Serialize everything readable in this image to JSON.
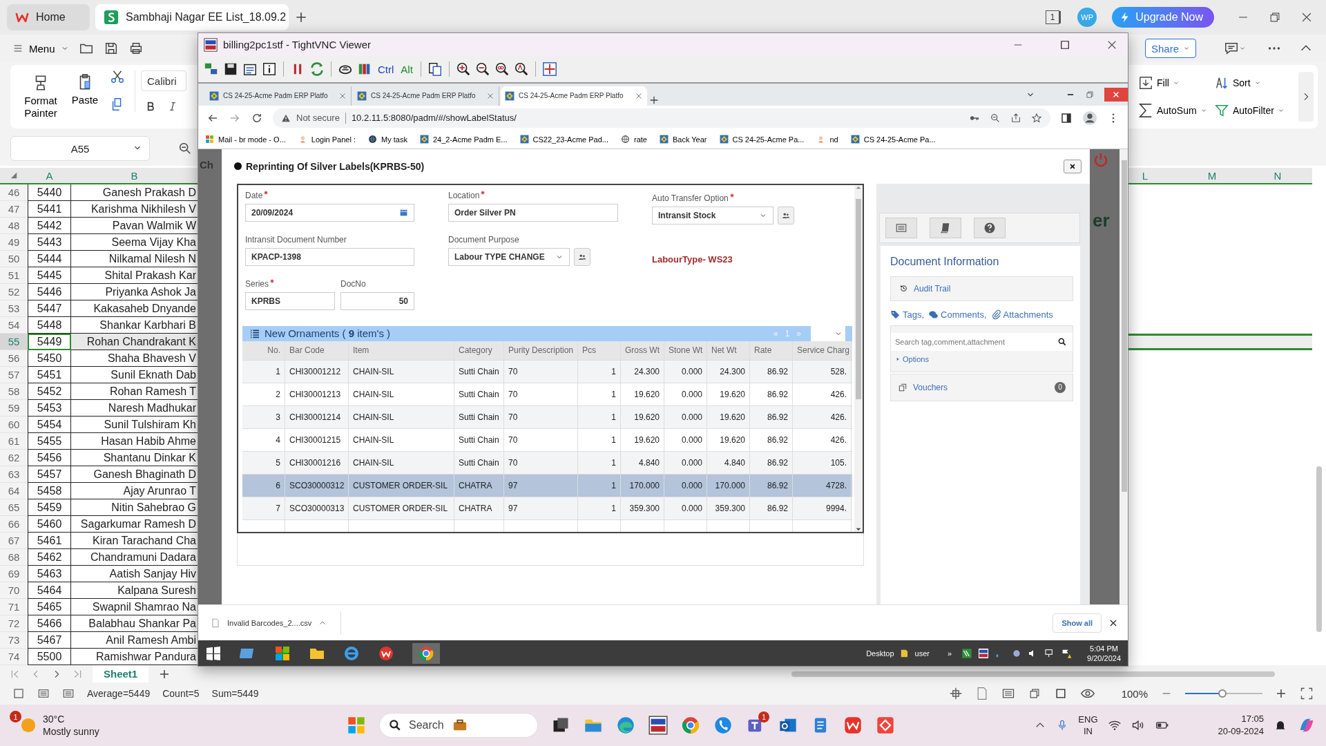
{
  "wps": {
    "tabs": [
      {
        "label": "Home",
        "selected": false
      },
      {
        "label": "Sambhaji Nagar EE List_18.09.2",
        "selected": true
      }
    ],
    "window_count": "1",
    "avatar": "WP",
    "upgrade": "Upgrade Now",
    "menu": "Menu",
    "share": "Share",
    "ribbon_left": [
      "Format Painter",
      "Paste"
    ],
    "font": "Calibri",
    "ribbon_right": [
      "Fill",
      "Sort",
      "AutoSum",
      "AutoFilter"
    ],
    "name_box": "A55"
  },
  "sheet": {
    "columns_left": [
      "A",
      "B"
    ],
    "columns_right": [
      "L",
      "M",
      "N"
    ],
    "rows": [
      {
        "num": "46",
        "a": "5440",
        "b": "Ganesh Prakash D",
        "selected": false
      },
      {
        "num": "47",
        "a": "5441",
        "b": "Karishma Nikhilesh V",
        "selected": false
      },
      {
        "num": "48",
        "a": "5442",
        "b": "Pavan Walmik W",
        "selected": false
      },
      {
        "num": "49",
        "a": "5443",
        "b": "Seema Vijay Kha",
        "selected": false
      },
      {
        "num": "50",
        "a": "5444",
        "b": "Nilkamal Nilesh N",
        "selected": false
      },
      {
        "num": "51",
        "a": "5445",
        "b": "Shital Prakash Kar",
        "selected": false
      },
      {
        "num": "52",
        "a": "5446",
        "b": "Priyanka Ashok Ja",
        "selected": false
      },
      {
        "num": "53",
        "a": "5447",
        "b": "Kakasaheb Dnyande",
        "selected": false
      },
      {
        "num": "54",
        "a": "5448",
        "b": "Shankar Karbhari B",
        "selected": false
      },
      {
        "num": "55",
        "a": "5449",
        "b": "Rohan Chandrakant K",
        "selected": true
      },
      {
        "num": "56",
        "a": "5450",
        "b": "Shaha Bhavesh V",
        "selected": false
      },
      {
        "num": "57",
        "a": "5451",
        "b": "Sunil Eknath Dab",
        "selected": false
      },
      {
        "num": "58",
        "a": "5452",
        "b": "Rohan Ramesh T",
        "selected": false
      },
      {
        "num": "59",
        "a": "5453",
        "b": "Naresh Madhukar",
        "selected": false
      },
      {
        "num": "60",
        "a": "5454",
        "b": "Sunil Tulshiram Kh",
        "selected": false
      },
      {
        "num": "61",
        "a": "5455",
        "b": "Hasan Habib Ahme",
        "selected": false
      },
      {
        "num": "62",
        "a": "5456",
        "b": "Shantanu Dinkar K",
        "selected": false
      },
      {
        "num": "63",
        "a": "5457",
        "b": "Ganesh Bhaginath D",
        "selected": false
      },
      {
        "num": "64",
        "a": "5458",
        "b": "Ajay Arunrao T",
        "selected": false
      },
      {
        "num": "65",
        "a": "5459",
        "b": "Nitin Sahebrao G",
        "selected": false
      },
      {
        "num": "66",
        "a": "5460",
        "b": "Sagarkumar Ramesh D",
        "selected": false
      },
      {
        "num": "67",
        "a": "5461",
        "b": "Kiran Tarachand Cha",
        "selected": false
      },
      {
        "num": "68",
        "a": "5462",
        "b": "Chandramuni Dadara",
        "selected": false
      },
      {
        "num": "69",
        "a": "5463",
        "b": "Aatish Sanjay Hiv",
        "selected": false
      },
      {
        "num": "70",
        "a": "5464",
        "b": "Kalpana Suresh",
        "selected": false
      },
      {
        "num": "71",
        "a": "5465",
        "b": "Swapnil Shamrao Na",
        "selected": false
      },
      {
        "num": "72",
        "a": "5466",
        "b": "Balabhau Shankar Pa",
        "selected": false
      },
      {
        "num": "73",
        "a": "5467",
        "b": "Anil Ramesh Ambi",
        "selected": false
      },
      {
        "num": "74",
        "a": "5500",
        "b": "Ramishwar Pandura",
        "selected": false
      }
    ],
    "sheet_tab": "Sheet1",
    "status": [
      "Average=5449",
      "Count=5",
      "Sum=5449"
    ],
    "zoom": {
      "reading": "100%",
      "level": 0.48
    }
  },
  "vnc": {
    "title": "billing2pc1stf - TightVNC Viewer",
    "keys": [
      "Ctrl",
      "Alt"
    ]
  },
  "browser": {
    "tabs": [
      {
        "label": "CS 24-25-Acme Padm ERP Platfo",
        "selected": false
      },
      {
        "label": "CS 24-25-Acme Padm ERP Platfo",
        "selected": false
      },
      {
        "label": "CS 24-25-Acme Padm ERP Platfo",
        "selected": true
      }
    ],
    "security": "Not secure",
    "url": "10.2.11.5:8080/padm/#/showLabelStatus/",
    "bookmarks": [
      "Mail - br mode - O...",
      "Login Panel :",
      "My task",
      "24_2-Acme Padm E...",
      "CS22_23-Acme Pad...",
      "rate",
      "Back Year",
      "CS 24-25-Acme Pa...",
      "nd",
      "CS 24-25-Acme Pa..."
    ],
    "backdrop_fragments": [
      "Ch",
      "er"
    ]
  },
  "dialog": {
    "title": "Reprinting Of Silver Labels(KPRBS-50)",
    "fields": [
      {
        "label": "Date",
        "required": true,
        "kind": "date",
        "value": "20/09/2024",
        "action": false
      },
      {
        "label": "Location",
        "required": true,
        "kind": "text",
        "value": "Order Silver PN",
        "action": false
      },
      {
        "label": "Auto Transfer Option",
        "required": true,
        "kind": "select",
        "value": "Intransit Stock",
        "action": true
      },
      {
        "label": "Intransit Document Number",
        "required": false,
        "kind": "text",
        "value": "KPACP-1398",
        "action": false
      },
      {
        "label": "Document Purpose",
        "required": false,
        "kind": "select",
        "value": "Labour TYPE CHANGE",
        "action": true
      },
      {
        "kind": "note",
        "value": "LabourType- WS23"
      },
      {
        "label": "Series",
        "required": true,
        "kind": "text",
        "value": "KPRBS",
        "action": false
      },
      {
        "label": "DocNo",
        "required": false,
        "kind": "number",
        "value": "50",
        "action": false
      }
    ],
    "grid": {
      "title": "New Ornaments ( **9** item's )",
      "pager": [
        "«",
        "1",
        "»"
      ],
      "columns": [
        "No.",
        "Bar Code",
        "Item",
        "Category",
        "Purity Description",
        "Pcs",
        "Gross Wt",
        "Stone Wt",
        "Net Wt",
        "Rate",
        "Service Charg"
      ],
      "rows": [
        {
          "cells": [
            "1",
            "CHI30001212",
            "CHAIN-SIL",
            "Sutti Chain",
            "70",
            "1",
            "24.300",
            "0.000",
            "24.300",
            "86.92",
            "528."
          ],
          "selected": false
        },
        {
          "cells": [
            "2",
            "CHI30001213",
            "CHAIN-SIL",
            "Sutti Chain",
            "70",
            "1",
            "19.620",
            "0.000",
            "19.620",
            "86.92",
            "426."
          ],
          "selected": false
        },
        {
          "cells": [
            "3",
            "CHI30001214",
            "CHAIN-SIL",
            "Sutti Chain",
            "70",
            "1",
            "19.620",
            "0.000",
            "19.620",
            "86.92",
            "426."
          ],
          "selected": false
        },
        {
          "cells": [
            "4",
            "CHI30001215",
            "CHAIN-SIL",
            "Sutti Chain",
            "70",
            "1",
            "19.620",
            "0.000",
            "19.620",
            "86.92",
            "426."
          ],
          "selected": false
        },
        {
          "cells": [
            "5",
            "CHI30001216",
            "CHAIN-SIL",
            "Sutti Chain",
            "70",
            "1",
            "4.840",
            "0.000",
            "4.840",
            "86.92",
            "105."
          ],
          "selected": false
        },
        {
          "cells": [
            "6",
            "SCO30000312",
            "CUSTOMER ORDER-SIL",
            "CHATRA",
            "97",
            "1",
            "170.000",
            "0.000",
            "170.000",
            "86.92",
            "4728."
          ],
          "selected": true
        },
        {
          "cells": [
            "7",
            "SCO30000313",
            "CUSTOMER ORDER-SIL",
            "CHATRA",
            "97",
            "1",
            "359.300",
            "0.000",
            "359.300",
            "86.92",
            "9994."
          ],
          "selected": false
        }
      ]
    }
  },
  "side_panel": {
    "heading": "Document Information",
    "audit": "Audit Trail",
    "links": [
      "Tags,",
      "Comments,",
      "Attachments"
    ],
    "search_placeholder": "Search tag,comment,attachment",
    "options": "Options",
    "vouchers": "Vouchers",
    "voucher_count": "0"
  },
  "download": {
    "file": "Invalid Barcodes_2....csv",
    "show_all": "Show all"
  },
  "remote_taskbar": {
    "desktop": "Desktop",
    "user": "user",
    "overflow": "»",
    "time": "5:04 PM",
    "date": "9/20/2024"
  },
  "taskbar": {
    "weather_badge": "1",
    "temp": "30°C",
    "weather": "Mostly sunny",
    "search": "Search",
    "teams_badge": "1",
    "lang": "ENG",
    "region": "IN",
    "time": "17:05",
    "date": "20-09-2024"
  }
}
